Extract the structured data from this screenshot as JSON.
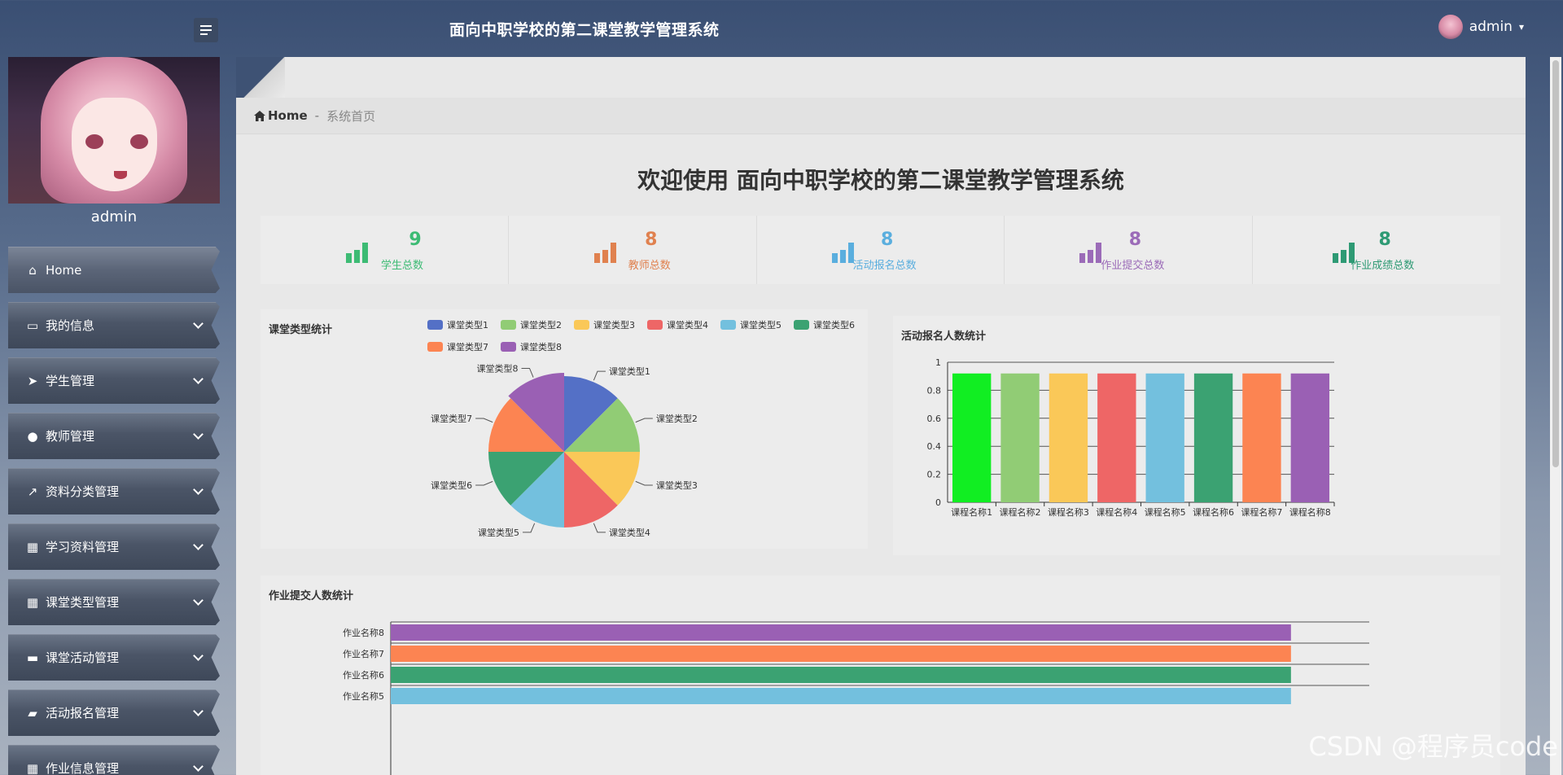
{
  "header": {
    "system_title": "面向中职学校的第二课堂教学管理系统",
    "user_name": "admin",
    "caret": "▾"
  },
  "sidebar": {
    "profile_name": "admin",
    "items": [
      {
        "label": "Home",
        "icon": "home-icon",
        "glyph": "⌂"
      },
      {
        "label": "我的信息",
        "icon": "id-card-icon",
        "glyph": "▭"
      },
      {
        "label": "学生管理",
        "icon": "paper-plane-icon",
        "glyph": "➤"
      },
      {
        "label": "教师管理",
        "icon": "user-icon",
        "glyph": "●"
      },
      {
        "label": "资料分类管理",
        "icon": "line-chart-icon",
        "glyph": "↗"
      },
      {
        "label": "学习资料管理",
        "icon": "grid-icon",
        "glyph": "▦"
      },
      {
        "label": "课堂类型管理",
        "icon": "grid-icon",
        "glyph": "▦"
      },
      {
        "label": "课堂活动管理",
        "icon": "comment-icon",
        "glyph": "▬"
      },
      {
        "label": "活动报名管理",
        "icon": "ticket-icon",
        "glyph": "▰"
      },
      {
        "label": "作业信息管理",
        "icon": "grid-icon",
        "glyph": "▦"
      }
    ]
  },
  "breadcrumb": {
    "home": "Home",
    "separator": "-",
    "current": "系统首页"
  },
  "welcome": "欢迎使用 面向中职学校的第二课堂教学管理系统",
  "stats": [
    {
      "value": "9",
      "label": "学生总数",
      "color": "#3dbb74"
    },
    {
      "value": "8",
      "label": "教师总数",
      "color": "#e0814f"
    },
    {
      "value": "8",
      "label": "活动报名总数",
      "color": "#5aaede"
    },
    {
      "value": "8",
      "label": "作业提交总数",
      "color": "#9b6bb8"
    },
    {
      "value": "8",
      "label": "作业成绩总数",
      "color": "#2e9a74"
    }
  ],
  "chart_data": [
    {
      "type": "pie",
      "title": "课堂类型统计",
      "categories": [
        "课堂类型1",
        "课堂类型2",
        "课堂类型3",
        "课堂类型4",
        "课堂类型5",
        "课堂类型6",
        "课堂类型7",
        "课堂类型8"
      ],
      "values": [
        1,
        1,
        1,
        1,
        1,
        1,
        1,
        1
      ],
      "colors": [
        "#5470c6",
        "#91cc75",
        "#fac858",
        "#ee6666",
        "#73c0de",
        "#3ba272",
        "#fc8452",
        "#9a60b4"
      ],
      "legend": "top-right"
    },
    {
      "type": "bar",
      "title": "活动报名人数统计",
      "categories": [
        "课程名称1",
        "课程名称2",
        "课程名称3",
        "课程名称4",
        "课程名称5",
        "课程名称6",
        "课程名称7",
        "课程名称8"
      ],
      "values": [
        0.92,
        0.92,
        0.92,
        0.92,
        0.92,
        0.92,
        0.92,
        0.92
      ],
      "colors": [
        "#11ee22",
        "#91cc75",
        "#fac858",
        "#ee6666",
        "#73c0de",
        "#3ba272",
        "#fc8452",
        "#9a60b4"
      ],
      "ylim": [
        0,
        1
      ],
      "yticks": [
        "0",
        "0.2",
        "0.4",
        "0.6",
        "0.8",
        "1"
      ]
    },
    {
      "type": "bar",
      "orientation": "horizontal",
      "title": "作业提交人数统计",
      "categories": [
        "作业名称8",
        "作业名称7",
        "作业名称6",
        "作业名称5"
      ],
      "values": [
        0.92,
        0.92,
        0.92,
        0.92
      ],
      "colors": [
        "#9a60b4",
        "#fc8452",
        "#3ba272",
        "#73c0de"
      ],
      "xlim": [
        0,
        1
      ]
    }
  ],
  "watermark": "CSDN @程序员code"
}
